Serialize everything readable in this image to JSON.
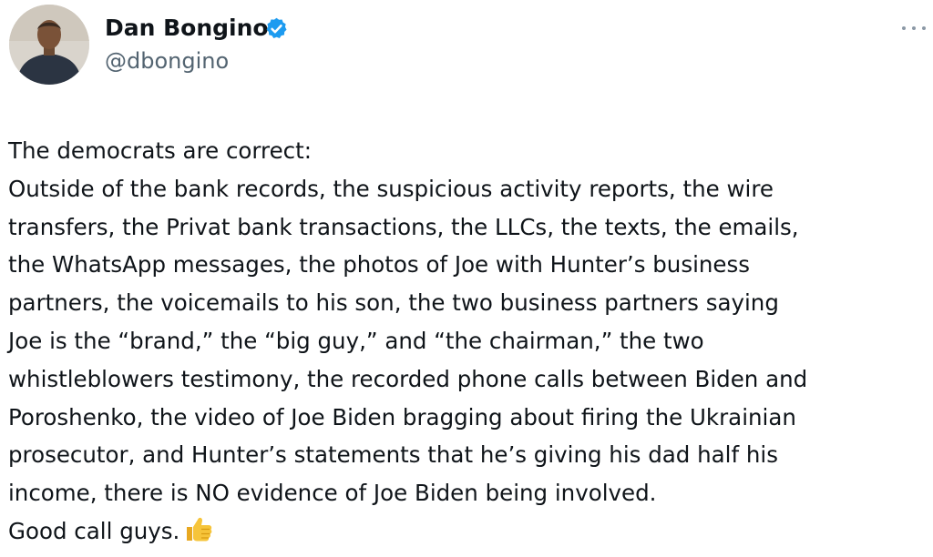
{
  "author": {
    "display_name": "Dan Bongino",
    "handle": "@dbongino",
    "verified": true,
    "avatar_icon": "profile-photo",
    "verified_icon": "verified-badge-icon",
    "verified_color": "#1d9bf0"
  },
  "menu": {
    "icon": "more-options-icon"
  },
  "tweet": {
    "lines": [
      "The democrats are correct:",
      "Outside of the bank records, the suspicious activity reports, the wire",
      "transfers, the Privat bank transactions, the LLCs, the texts, the emails,",
      "the WhatsApp messages, the photos of Joe with Hunter’s business",
      "partners, the voicemails to his son, the two business partners saying",
      "Joe is the “brand,” the “big guy,” and “the chairman,” the two",
      "whistleblowers testimony, the recorded phone calls between Biden and",
      "Poroshenko, the video of Joe Biden bragging about firing the Ukrainian",
      "prosecutor, and Hunter’s statements that he’s giving his dad half his",
      "income, there is NO evidence of Joe Biden being involved.",
      "Good call guys."
    ],
    "closing_emoji": "thumbs-up-icon"
  }
}
